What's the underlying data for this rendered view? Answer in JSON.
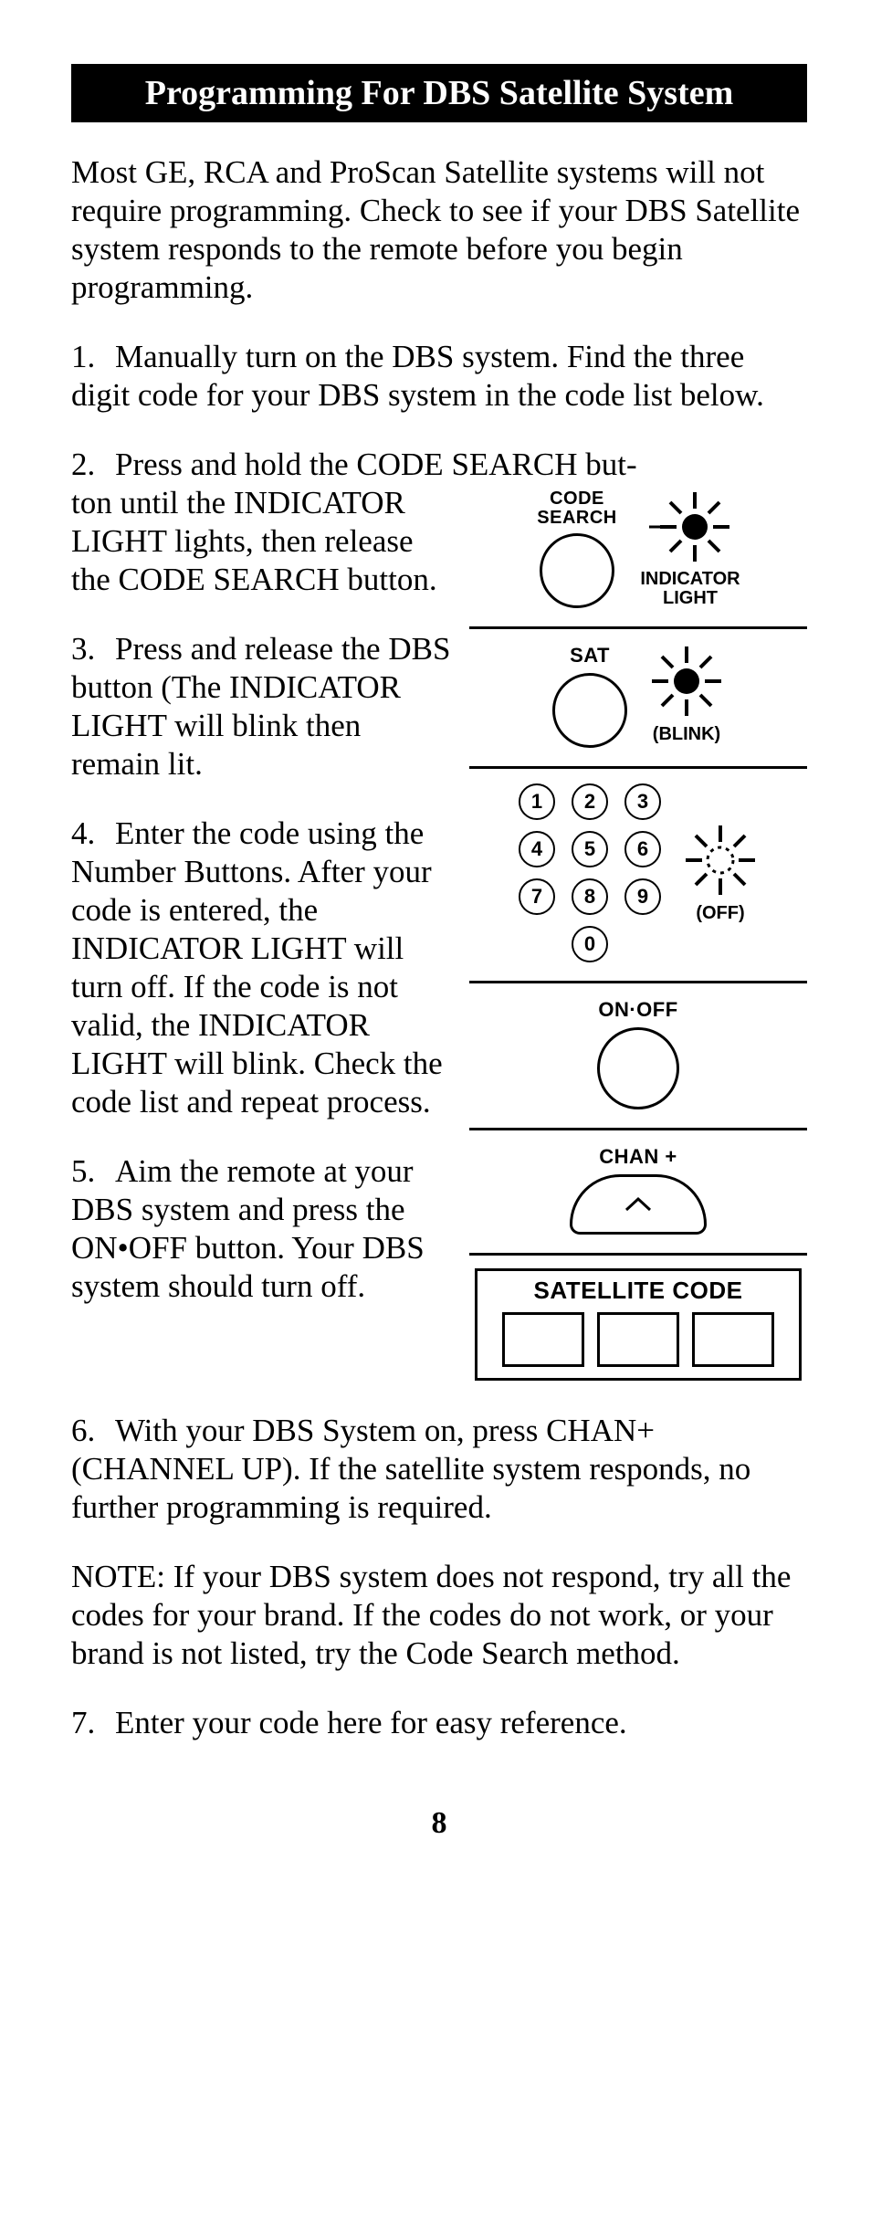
{
  "title": "Programming For DBS Satellite System",
  "intro": "Most GE, RCA and ProScan Satellite systems will not require programming. Check to see if your DBS Satellite system responds to the remote before you begin programming.",
  "steps": {
    "s1": "Manually turn on the DBS system. Find the three digit code for your DBS system in the code list below.",
    "s2a": "Press and hold the CODE SEARCH but-",
    "s2b": "ton until the INDICATOR LIGHT lights, then release the CODE SEARCH button.",
    "s3": "Press and release the DBS button (The INDICATOR LIGHT will blink then remain lit.",
    "s4": "Enter the code using the Number Buttons. After your code is entered, the INDICATOR LIGHT will turn off. If the code is not valid, the INDICATOR LIGHT will blink. Check the code list and repeat process.",
    "s5": "Aim the remote at your DBS system and press the ON•OFF button. Your DBS system should turn off.",
    "s6": "With your DBS System on, press CHAN+ (CHANNEL UP). If the satellite system responds, no further programming is required.",
    "s7": "Enter your code here for easy reference."
  },
  "note": "NOTE: If your DBS system does not respond, try all the codes for your brand. If the codes do not work, or your brand is not listed, try the Code Search method.",
  "labels": {
    "code_search": "CODE SEARCH",
    "indicator_light": "INDICATOR LIGHT",
    "sat": "SAT",
    "blink": "(BLINK)",
    "off": "(OFF)",
    "onoff": "ON·OFF",
    "chan": "CHAN +",
    "sat_code": "SATELLITE CODE"
  },
  "keypad": [
    "1",
    "2",
    "3",
    "4",
    "5",
    "6",
    "7",
    "8",
    "9",
    "0"
  ],
  "nums": {
    "n1": "1.",
    "n2": "2.",
    "n3": "3.",
    "n4": "4.",
    "n5": "5.",
    "n6": "6.",
    "n7": "7."
  },
  "page": "8"
}
